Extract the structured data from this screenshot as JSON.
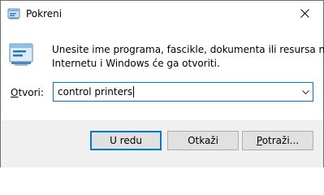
{
  "window": {
    "title": "Pokreni"
  },
  "description": {
    "line1": "Unesite ime programa, fascikle, dokumenta ili resursa na",
    "line2": "Internetu i Windows će ga otvoriti."
  },
  "open_field": {
    "label_mnemonic": "O",
    "label_rest": "tvori:",
    "value": "control printers"
  },
  "buttons": {
    "ok": "U redu",
    "cancel": "Otkaži",
    "browse_mnemonic": "P",
    "browse_rest": "otraži..."
  },
  "icons": {
    "title_icon": "run-icon",
    "app_icon": "run-icon",
    "close": "close-icon",
    "dropdown": "chevron-down-icon"
  },
  "colors": {
    "accent": "#0078d7",
    "footer_bg": "#f0f0f0",
    "button_bg": "#e1e1e1"
  }
}
